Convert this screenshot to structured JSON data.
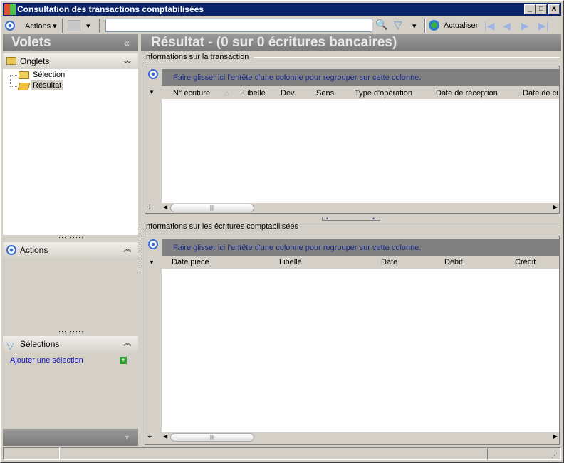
{
  "window": {
    "title": "Consultation des transactions comptabilisées",
    "min": "_",
    "max": "□",
    "close": "X"
  },
  "toolbar": {
    "actions_label": "Actions",
    "search_value": "",
    "refresh_label": "Actualiser"
  },
  "left": {
    "title": "Volets",
    "collapse": "«",
    "onglets": {
      "label": "Onglets",
      "items": [
        "Sélection",
        "Résultat"
      ]
    },
    "actions": {
      "label": "Actions"
    },
    "selections": {
      "label": "Sélections",
      "add_link": "Ajouter une sélection"
    }
  },
  "main": {
    "title": "Résultat - (0 sur 0 écritures bancaires)",
    "group_hint": "Faire glisser ici l'entête d'une colonne pour regrouper sur cette colonne.",
    "transaction": {
      "label": "Informations sur la transaction",
      "columns": [
        "N° écriture",
        "Libellé",
        "Dev.",
        "Sens",
        "Type d'opération",
        "Date de réception",
        "Date de cr"
      ]
    },
    "ecritures": {
      "label": "Informations sur les écritures comptabilisées",
      "columns": [
        "Date pièce",
        "Libellé",
        "Date",
        "Débit",
        "Crédit"
      ]
    }
  }
}
